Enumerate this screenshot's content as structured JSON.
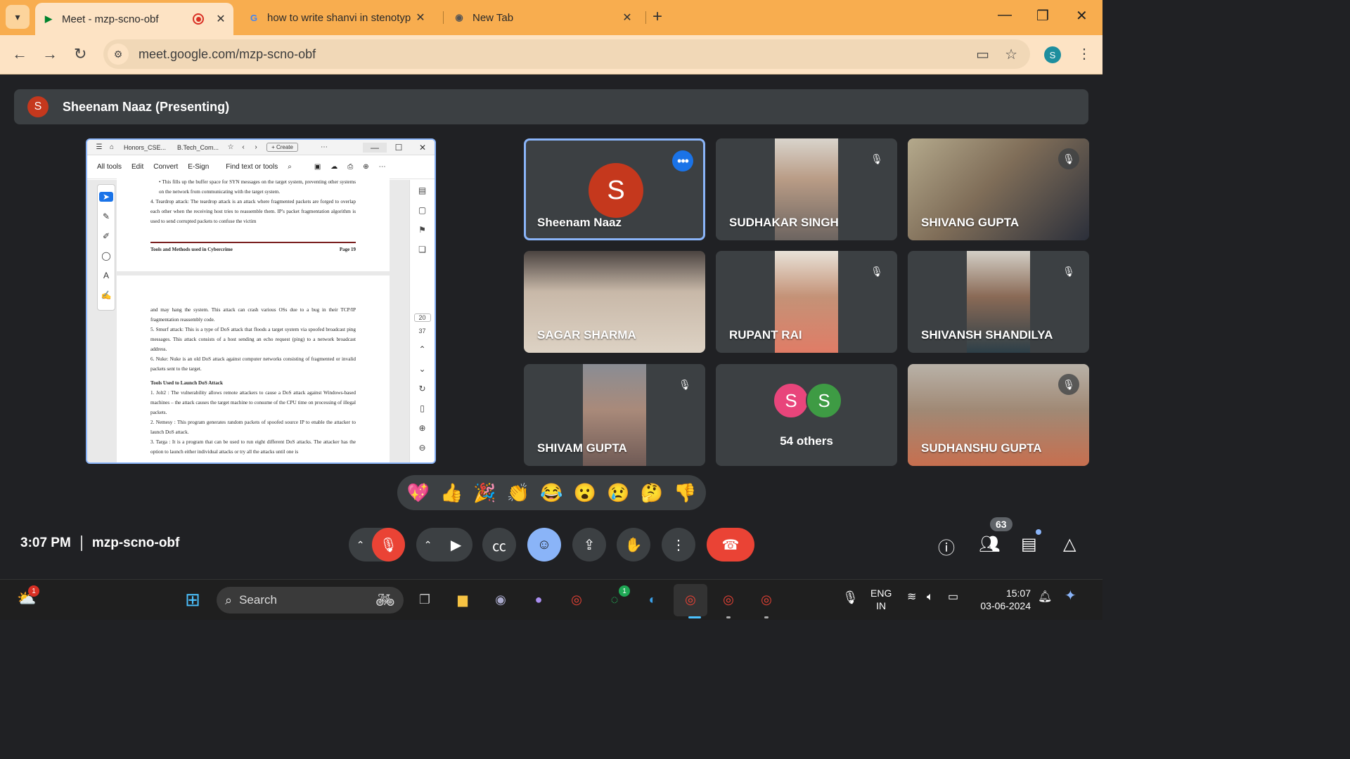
{
  "browser": {
    "tabs": [
      {
        "title": "Meet - mzp-scno-obf",
        "active": true
      },
      {
        "title": "how to write shanvi in stenotyp",
        "active": false
      },
      {
        "title": "New Tab",
        "active": false
      }
    ],
    "url": "meet.google.com/mzp-scno-obf",
    "profile_initial": "S"
  },
  "meet": {
    "presenting_label": "Sheenam Naaz (Presenting)",
    "presenter_initial": "S",
    "participants": [
      {
        "name": "Sheenam Naaz",
        "initial": "S",
        "muted": false,
        "speaking": true
      },
      {
        "name": "SUDHAKAR SINGH",
        "muted": true
      },
      {
        "name": "SHIVANG GUPTA",
        "muted": true
      },
      {
        "name": "SAGAR SHARMA",
        "muted": false
      },
      {
        "name": "RUPANT RAI",
        "muted": true
      },
      {
        "name": "SHIVANSH SHANDILYA",
        "muted": true
      },
      {
        "name": "SHIVAM GUPTA",
        "muted": true
      },
      {
        "name": "SUDHANSHU GUPTA",
        "muted": true
      }
    ],
    "others": {
      "label": "54 others",
      "initials": [
        "S",
        "S"
      ],
      "colors": [
        "#e8457b",
        "#3e9b44"
      ]
    },
    "reactions": [
      "💖",
      "👍",
      "🎉",
      "👏",
      "😂",
      "😮",
      "😢",
      "🤔",
      "👎"
    ],
    "time": "3:07 PM",
    "meeting_code": "mzp-scno-obf",
    "people_count": "63"
  },
  "shared_doc": {
    "tabs": [
      "Honors_CSE...",
      "B.Tech_Com..."
    ],
    "create_label": "Create",
    "toolbar": [
      "All tools",
      "Edit",
      "Convert",
      "E-Sign",
      "Find text or tools"
    ],
    "p1_lines": [
      "• This fills up the buffer space for SYN messages on the target system, preventing other systems on the network from communicating with the target system.",
      "4. Teardrop attack: The teardrop attack is an attack where fragmented packets are forged to overlap each other when the receiving host tries to reassemble them. IP's packet fragmentation algorithm is used to send corrupted packets to confuse the victim"
    ],
    "footer_left": "Tools and Methods used in Cybercrime",
    "footer_right": "Page 19",
    "p2_lines": [
      "and may hang the system. This attack can crash various OSs due to a bug in their TCP/IP fragmentation reassembly code.",
      "5. Smurf attack: This is a type of DoS attack that floods a target system via spoofed broadcast ping messages. This attack consists of a host sending an echo request (ping) to a network broadcast address.",
      "6. Nuke: Nuke is an old DoS attack against computer networks consisting of fragmented or invalid packets sent to the target.",
      "Tools Used to Launch DoS Attack",
      "1. Jolt2 : The vulnerability allows remote attackers to cause a DoS attack against Windows-based machines – the attack causes the target machine to consume of the CPU time on processing of illegal packets.",
      "2. Nemesy : This program generates random packets of spoofed source IP to enable the attacker to launch DoS attack.",
      "3. Targa : It is a program that can be used to run eight different DoS attacks. The attacker has the option to launch either individual attacks or try all the attacks until one is"
    ],
    "page_current": "20",
    "page_total": "37"
  },
  "taskbar": {
    "search_label": "Search",
    "weather_badge": "1",
    "whatsapp_badge": "1",
    "lang_line1": "ENG",
    "lang_line2": "IN",
    "clock_time": "15:07",
    "clock_date": "03-06-2024"
  }
}
